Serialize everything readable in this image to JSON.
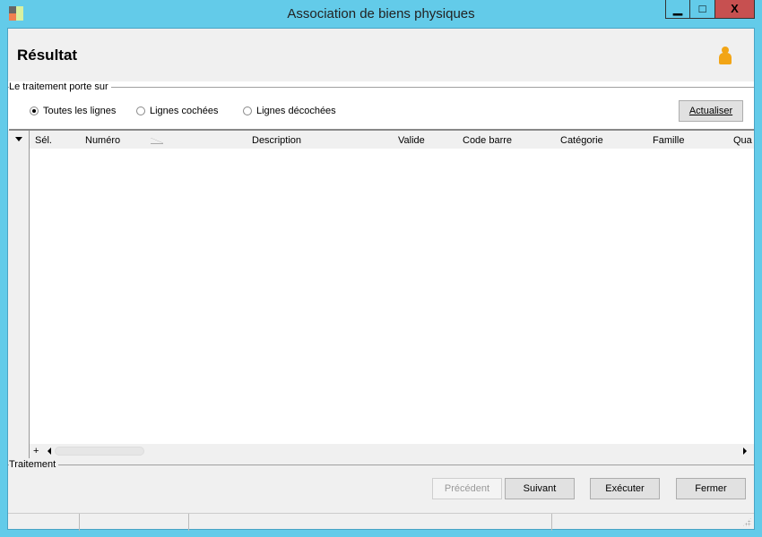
{
  "window": {
    "title": "Association de biens physiques",
    "minimize": "▁",
    "maximize": "□",
    "close": "X"
  },
  "header": {
    "title": "Résultat",
    "icon": "user-icon"
  },
  "scope": {
    "label": "Le traitement porte sur",
    "options": [
      {
        "label": "Toutes les lignes",
        "checked": true
      },
      {
        "label": "Lignes cochées",
        "checked": false
      },
      {
        "label": "Lignes décochées",
        "checked": false
      }
    ],
    "refresh": "Actualiser"
  },
  "grid": {
    "columns": [
      "Sél.",
      "Numéro",
      "Description",
      "Valide",
      "Code barre",
      "Catégorie",
      "Famille",
      "Qua"
    ],
    "rows": [],
    "add": "+"
  },
  "actions": {
    "label": "Traitement",
    "previous": "Précédent",
    "next": "Suivant",
    "execute": "Exécuter",
    "close": "Fermer"
  }
}
